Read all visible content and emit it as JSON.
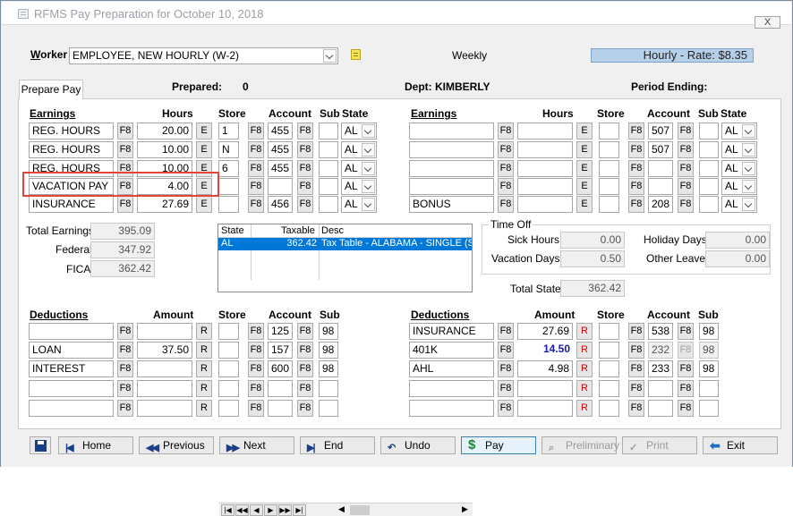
{
  "window": {
    "title": "RFMS Pay Preparation for October 10, 2018",
    "close_label": "X"
  },
  "header": {
    "worker_label": "Worker",
    "worker_value": "EMPLOYEE, NEW HOURLY (W-2)",
    "frequency": "Weekly",
    "rate": "Hourly - Rate: $8.35"
  },
  "tabs": {
    "prepare_pay": "Prepare Pay"
  },
  "info": {
    "prepared_label": "Prepared:",
    "prepared_value": "0",
    "dept_label": "Dept: KIMBERLY",
    "period_label": "Period Ending:"
  },
  "earnings_headers": {
    "earnings": "Earnings",
    "hours": "Hours",
    "store": "Store",
    "account": "Account",
    "sub": "Sub",
    "state": "State"
  },
  "buttons": {
    "f8": "F8",
    "e": "E",
    "r": "R"
  },
  "earnings_left": [
    {
      "name": "REG. HOURS",
      "hours": "20.00",
      "store": "1",
      "account": "455",
      "state": "AL"
    },
    {
      "name": "REG. HOURS",
      "hours": "10.00",
      "store": "N",
      "account": "455",
      "state": "AL"
    },
    {
      "name": "REG. HOURS",
      "hours": "10.00",
      "store": "6",
      "account": "455",
      "state": "AL"
    },
    {
      "name": "VACATION PAY",
      "hours": "4.00",
      "store": "",
      "account": "",
      "state": "AL"
    },
    {
      "name": "INSURANCE",
      "hours": "27.69",
      "store": "",
      "account": "456",
      "state": "AL"
    }
  ],
  "earnings_right": [
    {
      "name": "",
      "hours": "",
      "store": "",
      "account": "507",
      "state": "AL"
    },
    {
      "name": "",
      "hours": "",
      "store": "",
      "account": "507",
      "state": "AL"
    },
    {
      "name": "",
      "hours": "",
      "store": "",
      "account": "",
      "state": "AL"
    },
    {
      "name": "",
      "hours": "",
      "store": "",
      "account": "",
      "state": "AL"
    },
    {
      "name": "BONUS",
      "hours": "",
      "store": "",
      "account": "208",
      "state": "AL"
    }
  ],
  "totals": {
    "total_earnings_label": "Total Earnings",
    "total_earnings": "395.09",
    "federal_label": "Federal",
    "federal": "347.92",
    "fica_label": "FICA",
    "fica": "362.42",
    "total_state_label": "Total State",
    "total_state": "362.42"
  },
  "tax_table": {
    "headers": [
      "State",
      "Taxable",
      "Desc"
    ],
    "row": {
      "state": "AL",
      "taxable": "362.42",
      "desc": "Tax Table - ALABAMA - SINGLE (S"
    }
  },
  "time_off": {
    "label": "Time Off",
    "sick_hours_label": "Sick Hours",
    "sick_hours": "0.00",
    "vacation_days_label": "Vacation Days",
    "vacation_days": "0.50",
    "holiday_days_label": "Holiday Days",
    "holiday_days": "0.00",
    "other_leave_label": "Other Leave",
    "other_leave": "0.00"
  },
  "deductions_headers": {
    "deductions": "Deductions",
    "amount": "Amount",
    "store": "Store",
    "account": "Account",
    "sub": "Sub"
  },
  "deductions_left": [
    {
      "name": "",
      "amount": "",
      "account": "125",
      "sub": "98"
    },
    {
      "name": "LOAN",
      "amount": "37.50",
      "account": "157",
      "sub": "98"
    },
    {
      "name": "INTEREST",
      "amount": "",
      "account": "600",
      "sub": "98"
    },
    {
      "name": "",
      "amount": "",
      "account": "",
      "sub": ""
    },
    {
      "name": "",
      "amount": "",
      "account": "",
      "sub": ""
    }
  ],
  "deductions_right": [
    {
      "name": "INSURANCE",
      "amount": "27.69",
      "account": "538",
      "sub": "98"
    },
    {
      "name": "401K",
      "amount": "14.50",
      "account": "232",
      "sub": "98"
    },
    {
      "name": "AHL",
      "amount": "4.98",
      "account": "233",
      "sub": "98"
    },
    {
      "name": "",
      "amount": "",
      "account": "",
      "sub": ""
    },
    {
      "name": "",
      "amount": "",
      "account": "",
      "sub": ""
    }
  ],
  "toolbar": {
    "home": "Home",
    "previous": "Previous",
    "next": "Next",
    "end": "End",
    "undo": "Undo",
    "pay": "Pay",
    "preliminary": "Preliminary",
    "print": "Print",
    "exit": "Exit"
  },
  "colors": {
    "rate_bg": "#b7d0ea",
    "highlight_border": "#e0463a",
    "selection_bg": "#0078d7",
    "r_button_text": "#d40000",
    "blue_amount": "#1a1aa8"
  }
}
